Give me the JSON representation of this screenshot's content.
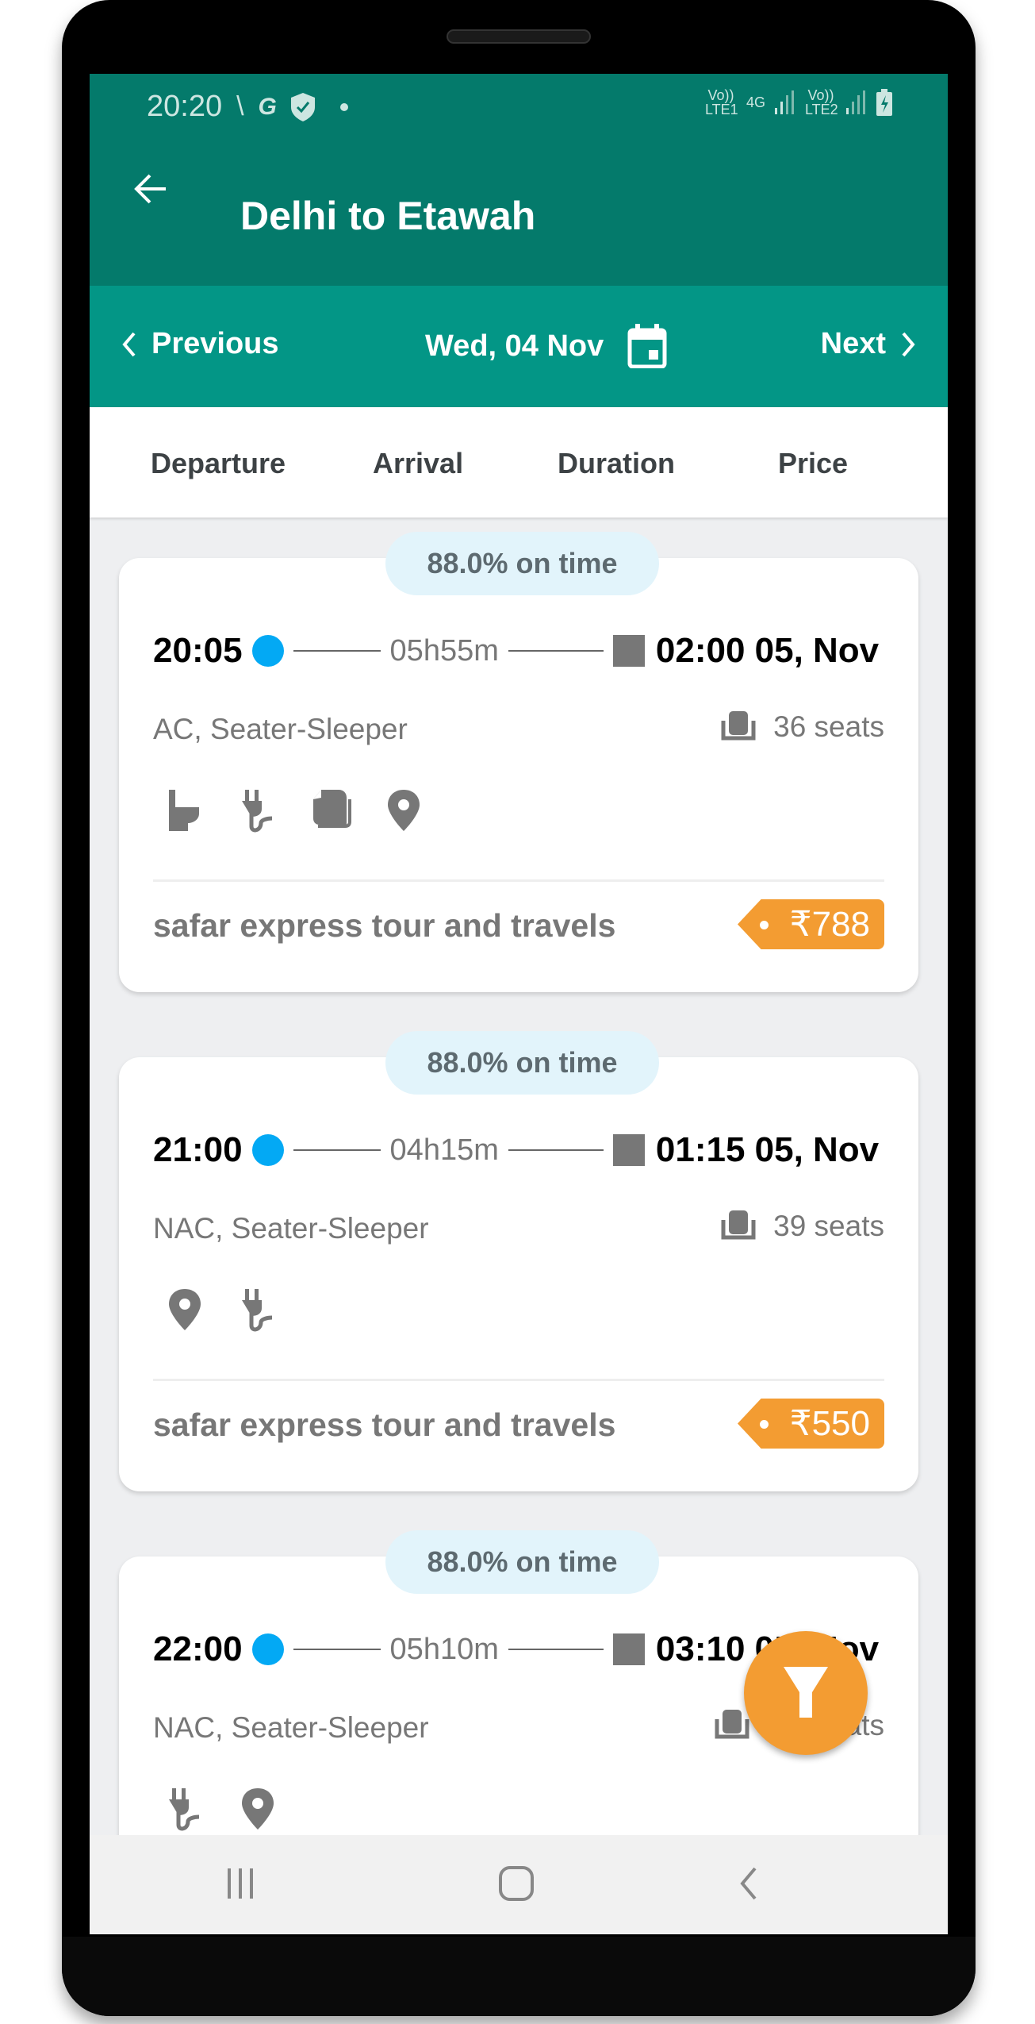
{
  "status_bar": {
    "time": "20:20",
    "left_icons": [
      "missed-call-icon",
      "g-icon",
      "shield-check-icon",
      "dot-icon"
    ],
    "right_icons": [
      "volte-lte1-icon",
      "4g-data-icon",
      "signal-icon",
      "volte-lte2-icon",
      "signal-icon",
      "battery-charging-icon"
    ],
    "lte1": "Vo)) LTE1",
    "net": "4G",
    "lte2": "Vo)) LTE2"
  },
  "header": {
    "title": "Delhi to Etawah",
    "back_icon": "arrow-left-icon"
  },
  "date_bar": {
    "previous": "Previous",
    "date": "Wed, 04 Nov",
    "next": "Next",
    "calendar_icon": "calendar-icon"
  },
  "sort_tabs": [
    "Departure",
    "Arrival",
    "Duration",
    "Price"
  ],
  "colors": {
    "header": "#047a6b",
    "datebar": "#039686",
    "accent": "#f39c32",
    "dot": "#03a9f4"
  },
  "buses": [
    {
      "on_time": "88.0% on time",
      "departure": "20:05",
      "duration": "05h55m",
      "arrival": "02:00 05, Nov",
      "type": "AC, Seater-Sleeper",
      "seats": "36 seats",
      "amenities": [
        "toilet-icon",
        "charging-plug-icon",
        "blanket-icon",
        "location-pin-icon"
      ],
      "operator": "safar express tour and travels",
      "price": "₹788"
    },
    {
      "on_time": "88.0% on time",
      "departure": "21:00",
      "duration": "04h15m",
      "arrival": "01:15 05, Nov",
      "type": "NAC, Seater-Sleeper",
      "seats": "39 seats",
      "amenities": [
        "location-pin-icon",
        "charging-plug-icon"
      ],
      "operator": "safar express tour and travels",
      "price": "₹550"
    },
    {
      "on_time": "88.0% on time",
      "departure": "22:00",
      "duration": "05h10m",
      "arrival": "03:10 05, Nov",
      "type": "NAC, Seater-Sleeper",
      "seats": "seats",
      "amenities": [
        "charging-plug-icon",
        "location-pin-icon"
      ]
    }
  ],
  "fab": {
    "icon": "filter-icon"
  },
  "nav_bar": [
    "recent-apps-icon",
    "home-icon",
    "back-icon"
  ]
}
